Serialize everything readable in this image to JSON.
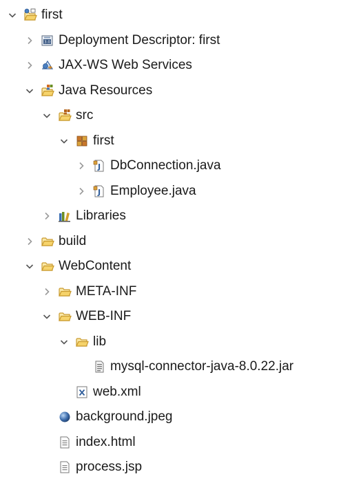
{
  "tree": [
    {
      "label": "first",
      "icon": "web-project-icon",
      "expander": "expanded",
      "depth": 0
    },
    {
      "label": "Deployment Descriptor: first",
      "icon": "deployment-descriptor-icon",
      "expander": "collapsed",
      "depth": 1
    },
    {
      "label": "JAX-WS Web Services",
      "icon": "web-services-icon",
      "expander": "collapsed",
      "depth": 1
    },
    {
      "label": "Java Resources",
      "icon": "java-resources-icon",
      "expander": "expanded",
      "depth": 1
    },
    {
      "label": "src",
      "icon": "source-folder-icon",
      "expander": "expanded",
      "depth": 2
    },
    {
      "label": "first",
      "icon": "package-icon",
      "expander": "expanded",
      "depth": 3
    },
    {
      "label": "DbConnection.java",
      "icon": "java-file-icon",
      "expander": "collapsed",
      "depth": 4
    },
    {
      "label": "Employee.java",
      "icon": "java-file-icon",
      "expander": "collapsed",
      "depth": 4
    },
    {
      "label": "Libraries",
      "icon": "libraries-icon",
      "expander": "collapsed",
      "depth": 2
    },
    {
      "label": "build",
      "icon": "folder-icon",
      "expander": "collapsed",
      "depth": 1
    },
    {
      "label": "WebContent",
      "icon": "folder-icon",
      "expander": "expanded",
      "depth": 1
    },
    {
      "label": "META-INF",
      "icon": "folder-icon",
      "expander": "collapsed",
      "depth": 2
    },
    {
      "label": "WEB-INF",
      "icon": "folder-icon",
      "expander": "expanded",
      "depth": 2
    },
    {
      "label": "lib",
      "icon": "folder-icon",
      "expander": "expanded",
      "depth": 3
    },
    {
      "label": "mysql-connector-java-8.0.22.jar",
      "icon": "jar-file-icon",
      "expander": "none",
      "depth": 4
    },
    {
      "label": "web.xml",
      "icon": "xml-file-icon",
      "expander": "none",
      "depth": 3
    },
    {
      "label": "background.jpeg",
      "icon": "image-file-icon",
      "expander": "none",
      "depth": 2
    },
    {
      "label": "index.html",
      "icon": "text-file-icon",
      "expander": "none",
      "depth": 2
    },
    {
      "label": "process.jsp",
      "icon": "text-file-icon",
      "expander": "none",
      "depth": 2
    }
  ]
}
